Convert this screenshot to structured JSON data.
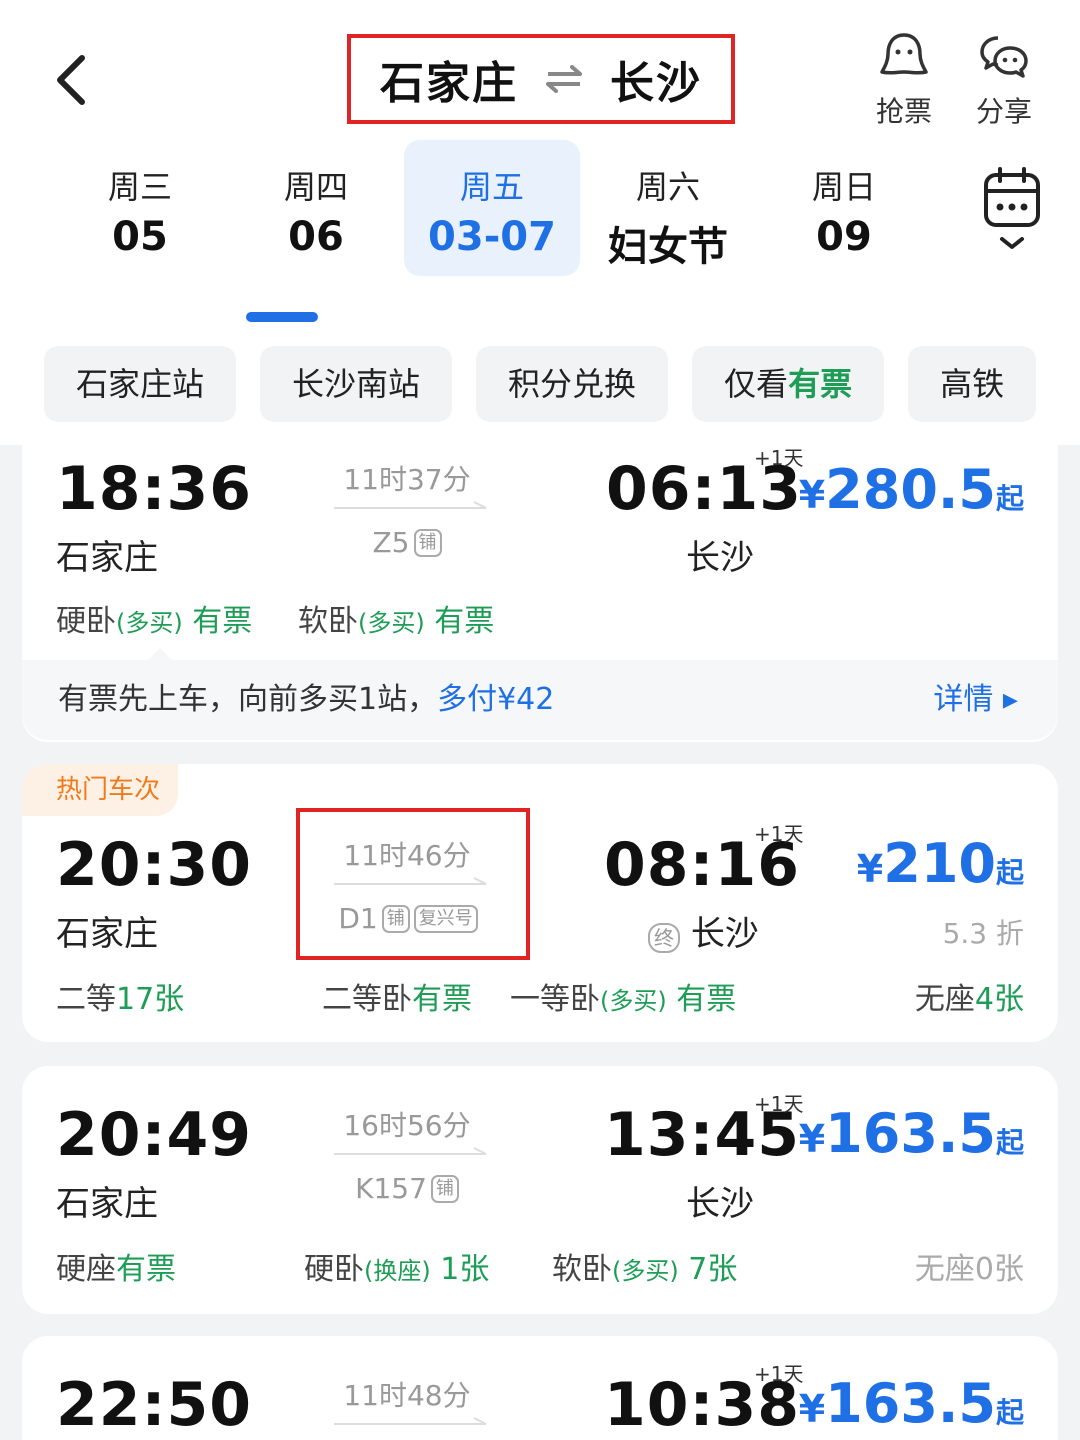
{
  "header": {
    "from_city": "石家庄",
    "to_city": "长沙",
    "grab_label": "抢票",
    "share_label": "分享"
  },
  "dates": [
    {
      "weekday": "周三",
      "day": "05"
    },
    {
      "weekday": "周四",
      "day": "06"
    },
    {
      "weekday": "周五",
      "day": "03-07",
      "active": true
    },
    {
      "weekday": "周六",
      "day": "妇女节"
    },
    {
      "weekday": "周日",
      "day": "09"
    }
  ],
  "filters": [
    "石家庄站",
    "长沙南站",
    "积分兑换",
    "仅看",
    "有票",
    "高铁"
  ],
  "trains": [
    {
      "depart_time": "18:36",
      "depart_station": "石家庄",
      "duration": "11时37分",
      "train_no": "Z5",
      "tag1": "铺",
      "arrive_time": "06:13",
      "arrive_station": "长沙",
      "plus_day": "+1天",
      "price_symbol": "¥",
      "price": "280.5",
      "price_suffix": "起",
      "seat1_name": "硬卧",
      "seat1_note": "(多买)",
      "seat1_status": "有票",
      "seat2_name": "软卧",
      "seat2_note": "(多买)",
      "seat2_status": "有票",
      "hint_text": "有票先上车，向前多买1站，",
      "hint_extra": "多付¥42",
      "hint_detail": "详情 ▸"
    },
    {
      "hot_label": "热门车次",
      "depart_time": "20:30",
      "depart_station": "石家庄",
      "duration": "11时46分",
      "train_no": "D1",
      "tag1": "铺",
      "tag2": "复兴号",
      "arrive_time": "08:16",
      "arrive_station": "长沙",
      "terminal_tag": "终",
      "plus_day": "+1天",
      "price_symbol": "¥",
      "price": "210",
      "price_suffix": "起",
      "discount": "5.3 折",
      "seat1_name": "二等",
      "seat1_status": "17张",
      "seat2_name": "二等卧",
      "seat2_status": "有票",
      "seat3_name": "一等卧",
      "seat3_note": "(多买)",
      "seat3_status": "有票",
      "seat4_name": "无座",
      "seat4_status": "4张"
    },
    {
      "depart_time": "20:49",
      "depart_station": "石家庄",
      "duration": "16时56分",
      "train_no": "K157",
      "tag1": "铺",
      "arrive_time": "13:45",
      "arrive_station": "长沙",
      "plus_day": "+1天",
      "price_symbol": "¥",
      "price": "163.5",
      "price_suffix": "起",
      "seat1_name": "硬座",
      "seat1_status": "有票",
      "seat2_name": "硬卧",
      "seat2_note": "(换座)",
      "seat2_status": "1张",
      "seat3_name": "软卧",
      "seat3_note": "(多买)",
      "seat3_status": "7张",
      "seat4_text": "无座0张"
    },
    {
      "depart_time": "22:50",
      "duration": "11时48分",
      "arrive_time": "10:38",
      "plus_day": "+1天",
      "price_symbol": "¥",
      "price": "163.5",
      "price_suffix": "起"
    }
  ],
  "colors": {
    "accent": "#1f6fe5",
    "available": "#1d9d55",
    "highlight_box": "#e02424",
    "hot": "#ef7b1c"
  }
}
